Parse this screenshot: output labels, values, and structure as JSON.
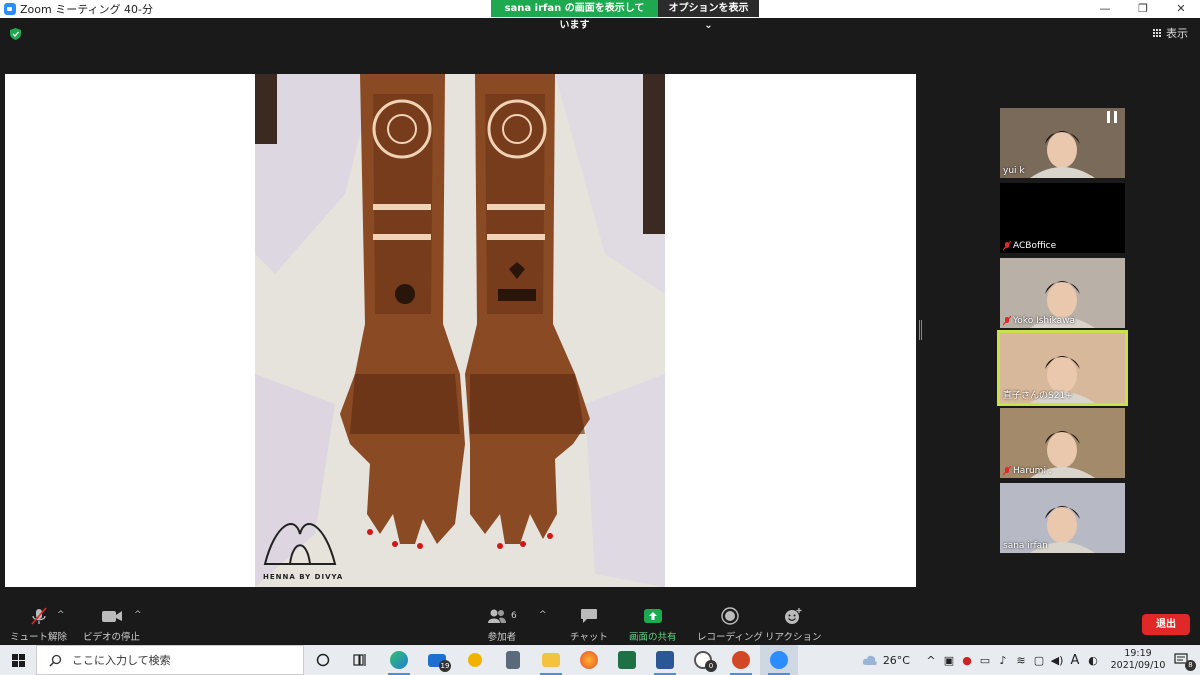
{
  "window": {
    "title": "Zoom ミーティング 40-分",
    "minimize": "—",
    "maximize": "❐",
    "close": "✕"
  },
  "share_banner": {
    "status": "sana  irfan の画面を表示しています",
    "options": "オプションを表示 ⌄"
  },
  "view_button": {
    "label": "表示"
  },
  "shared_content": {
    "watermark": "HENNA BY DIVYA"
  },
  "participants": [
    {
      "name": "yui k",
      "muted": false,
      "active": false,
      "bg": "#7a6a5a"
    },
    {
      "name": "ACBoffice",
      "muted": true,
      "active": false,
      "bg": "#000000"
    },
    {
      "name": "Yoko Ishikawa",
      "muted": true,
      "active": false,
      "bg": "#b9b1a8"
    },
    {
      "name": "直子さんのS21+",
      "muted": false,
      "active": true,
      "bg": "#d8b89a"
    },
    {
      "name": "Harumi .",
      "muted": true,
      "active": false,
      "bg": "#a38a6a"
    },
    {
      "name": "sana irfan",
      "muted": false,
      "active": false,
      "bg": "#b7b9c4"
    }
  ],
  "toolbar": {
    "mute_label": "ミュート解除",
    "video_label": "ビデオの停止",
    "participants_label": "参加者",
    "participants_count": "6",
    "chat_label": "チャット",
    "share_label": "画面の共有",
    "record_label": "レコーディング",
    "reaction_label": "リアクション",
    "leave_label": "退出",
    "share_color": "#1ea84f",
    "leave_color": "#e02828"
  },
  "taskbar": {
    "search_placeholder": "ここに入力して検索",
    "mail_badge": "19",
    "clock_badge": "0",
    "weather": "26°C",
    "ime": "A",
    "time": "19:19",
    "date": "2021/09/10",
    "notif_badge": "8"
  }
}
